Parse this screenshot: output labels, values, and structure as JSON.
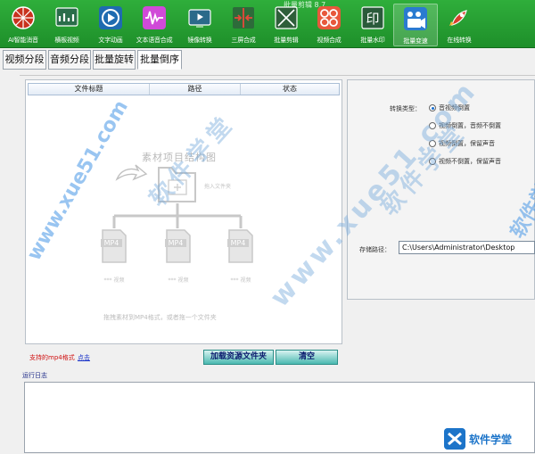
{
  "app_title": "批量剪辑 8.7",
  "toolbar": {
    "items": [
      {
        "label": "AI智能消音",
        "icon": "basketball-icon",
        "color": "#c8321e"
      },
      {
        "label": "横板视频",
        "icon": "chart-icon",
        "color": "#2a6d4a"
      },
      {
        "label": "文字动画",
        "icon": "video-circle-icon",
        "color": "#1f6bb0"
      },
      {
        "label": "文本语音合成",
        "icon": "waveform-icon",
        "color": "#d04ad8"
      },
      {
        "label": "镜像转换",
        "icon": "tv-icon",
        "color": "#2b6a8a"
      },
      {
        "label": "三屏合成",
        "icon": "split-arrows-icon",
        "color": "#2d6b3a"
      },
      {
        "label": "批量剪辑",
        "icon": "crop-icon",
        "color": "#2f5f3a"
      },
      {
        "label": "视频合成",
        "icon": "grid-icon",
        "color": "#e8583c"
      },
      {
        "label": "批量水印",
        "icon": "stamp-icon",
        "color": "#2a5a3a"
      },
      {
        "label": "批量变速",
        "icon": "film-icon",
        "color": "#2a7bd0"
      },
      {
        "label": "在线转换",
        "icon": "rocket-icon",
        "color": "#d8402c"
      }
    ]
  },
  "tabs": [
    "视频分段",
    "音频分段",
    "批量旋转",
    "批量倒序"
  ],
  "file_list": {
    "columns": [
      "文件标题",
      "路径",
      "状态"
    ],
    "placeholder_title": "素材项目结构图",
    "placeholder_hint": "拖拽素材到MP4格式，或者拖一个文件夹",
    "drop_label": "拖入文件夹",
    "file_tags": [
      "MP4",
      "MP4",
      "MP4"
    ],
    "file_captions": [
      "*** 视频",
      "*** 视频",
      "*** 视频"
    ]
  },
  "notes": {
    "support": "支持的mp4格式",
    "link": "点击"
  },
  "buttons": {
    "load": "加载资源文件夹",
    "clear": "清空"
  },
  "settings": {
    "conversion_label": "转换类型：",
    "options": [
      "音视频倒置",
      "视频倒置，音频不倒置",
      "视频倒置，保留声音",
      "视频不倒置，保留声音"
    ],
    "selected_index": 0,
    "save_label": "存储路径：",
    "save_path": "C:\\Users\\Administrator\\Desktop"
  },
  "log": {
    "label": "运行日志"
  },
  "watermark": {
    "a": "软件学堂",
    "b": "www.xue51.com",
    "brand": "软件学堂"
  }
}
